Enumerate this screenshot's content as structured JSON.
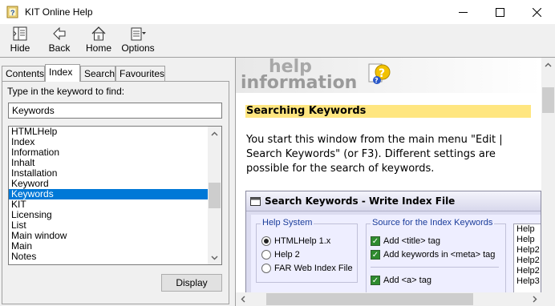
{
  "window": {
    "title": "KIT Online Help",
    "minimize": "minimize",
    "maximize": "maximize",
    "close": "close"
  },
  "toolbar": {
    "hide": "Hide",
    "back": "Back",
    "home": "Home",
    "options": "Options"
  },
  "tabs": [
    {
      "label": "Contents"
    },
    {
      "label": "Index"
    },
    {
      "label": "Search"
    },
    {
      "label": "Favourites"
    }
  ],
  "index": {
    "prompt": "Type in the keyword to find:",
    "query": "Keywords",
    "items": [
      "HTMLHelp",
      "Index",
      "Information",
      "Inhalt",
      "Installation",
      "Keyword",
      "Keywords",
      "KIT",
      "Licensing",
      "List",
      "Main window",
      "Main",
      "Notes"
    ],
    "selected_index": 6,
    "display_button": "Display"
  },
  "content": {
    "banner_text": "help information",
    "heading": "Searching Keywords",
    "paragraph": "You start this window from the main menu \"Edit | Search Keywords\" (or F3). Different settings are possible for the search of keywords.",
    "dialog": {
      "title": "Search Keywords - Write Index File",
      "help_system_group": "Help System",
      "help_system_options": [
        "HTMLHelp 1.x",
        "Help 2",
        "FAR Web Index File"
      ],
      "help_system_selected": 0,
      "source_group": "Source for the Index Keywords",
      "source_options": [
        "Add <title> tag",
        "Add keywords in <meta> tag",
        "Add <a> tag"
      ],
      "help_list": [
        "Help",
        "Help",
        "Help2",
        "Help2",
        "Help2",
        "Help3"
      ]
    }
  },
  "colors": {
    "selection": "#0078d7",
    "heading_bg": "#ffe680"
  }
}
